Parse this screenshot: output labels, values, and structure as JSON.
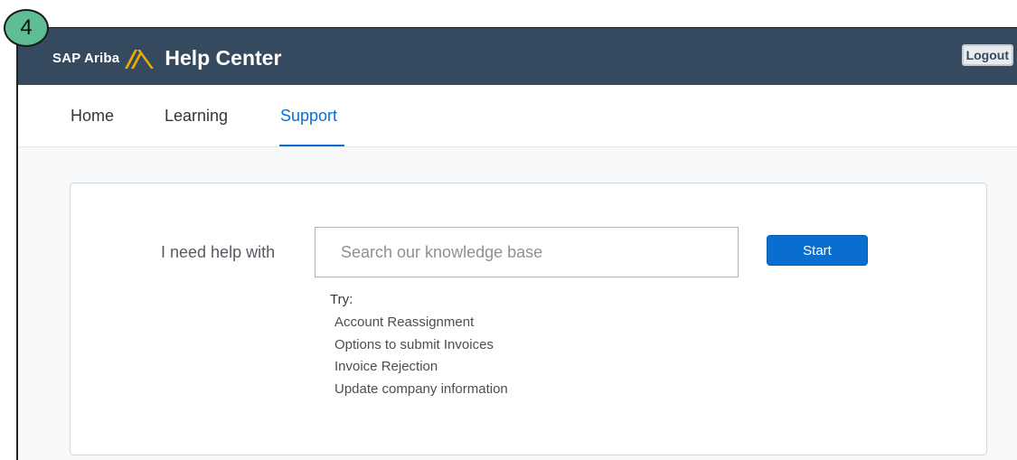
{
  "step_badge": "4",
  "header": {
    "brand_sap": "SAP Ariba",
    "title": "Help Center",
    "logout_label": "Logout",
    "bar_color": "#354a5f",
    "logo_color": "#f0ab00"
  },
  "nav": {
    "items": [
      {
        "label": "Home",
        "active": false
      },
      {
        "label": "Learning",
        "active": false
      },
      {
        "label": "Support",
        "active": true
      }
    ],
    "accent": "#0a6ed1"
  },
  "support": {
    "help_label": "I need help with",
    "search_placeholder": "Search our knowledge base",
    "search_value": "",
    "start_label": "Start",
    "try_label": "Try:",
    "suggestions": [
      "Account Reassignment",
      "Options to submit Invoices",
      "Invoice Rejection",
      "Update company information"
    ]
  }
}
